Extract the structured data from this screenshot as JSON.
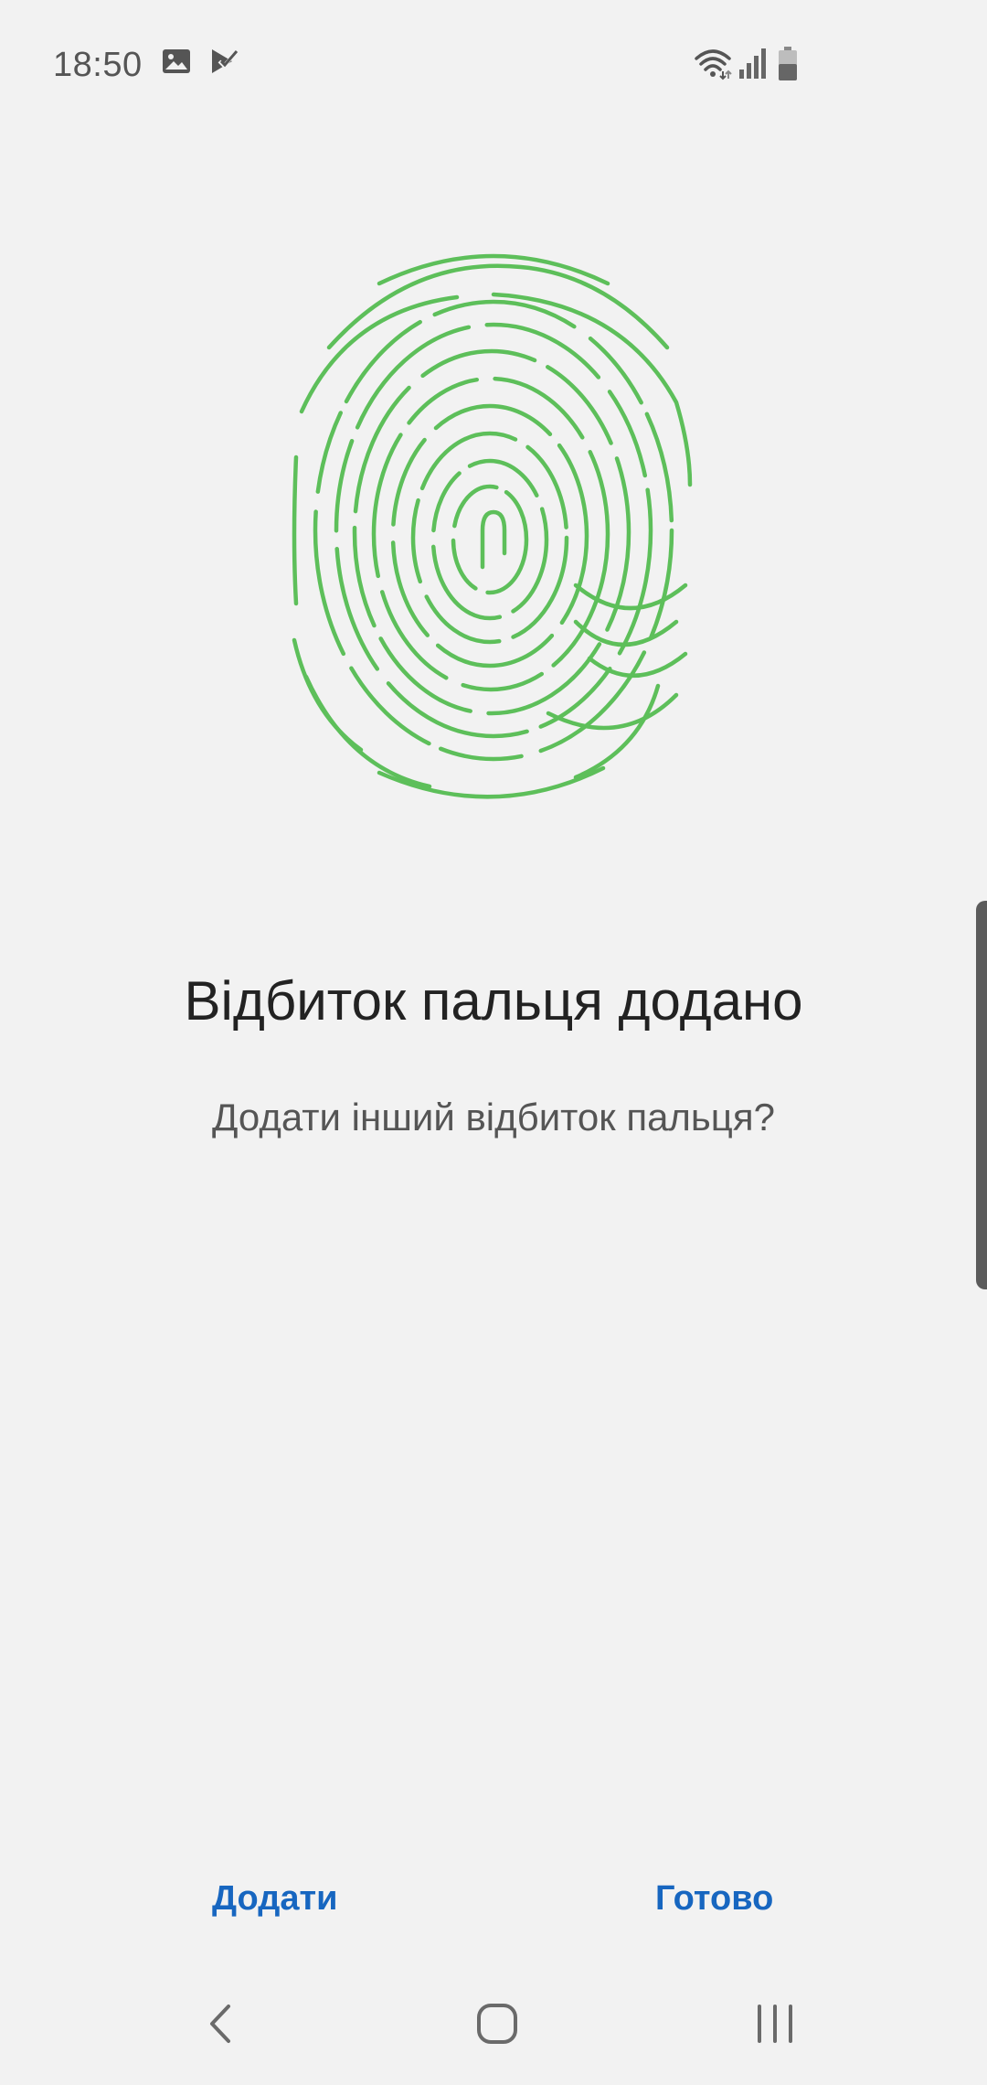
{
  "status_bar": {
    "time": "18:50",
    "icons": [
      "image-icon",
      "task-check-icon",
      "wifi-icon",
      "signal-icon",
      "battery-icon"
    ]
  },
  "illustration": {
    "icon": "fingerprint-icon",
    "color": "#5dbf5a"
  },
  "content": {
    "title": "Відбиток пальця додано",
    "subtitle": "Додати інший відбиток пальця?"
  },
  "actions": {
    "add_label": "Додати",
    "done_label": "Готово",
    "accent_color": "#1766c0"
  },
  "nav_bar": {
    "icons": [
      "back-icon",
      "home-icon",
      "recents-icon"
    ]
  }
}
